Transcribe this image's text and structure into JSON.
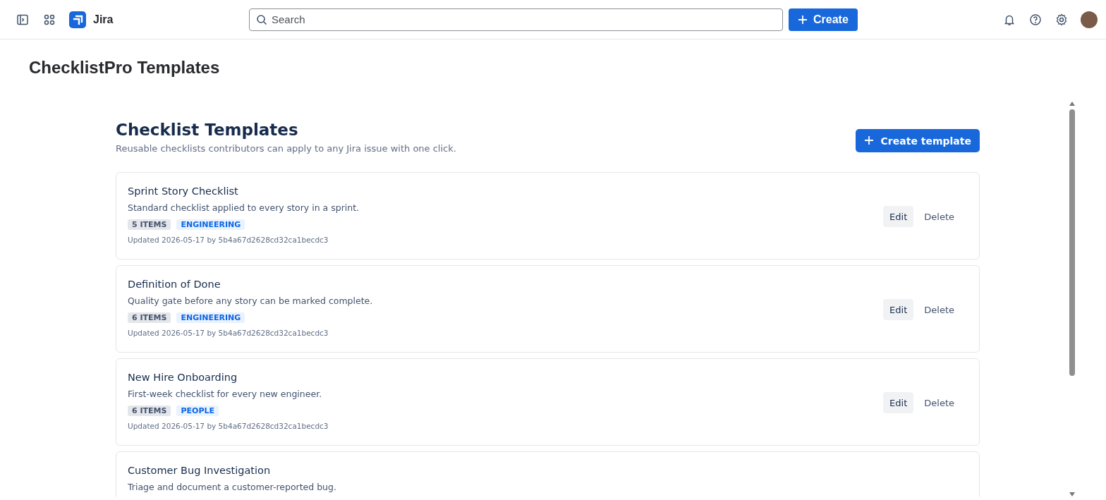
{
  "top_bar": {
    "product": "Jira",
    "search": {
      "placeholder": "Search"
    },
    "create_button": "Create"
  },
  "page_title": "ChecklistPro Templates",
  "section": {
    "title": "Checklist Templates",
    "subtitle": "Reusable checklists contributors can apply to any Jira issue with one click.",
    "create_button": "Create template"
  },
  "templates": [
    {
      "name": "Sprint Story Checklist",
      "description": "Standard checklist applied to every story in a sprint.",
      "count": "5 ITEMS",
      "category": "ENGINEERING",
      "updated": "Updated 2026-05-17 by 5b4a67d2628cd32ca1becdc3",
      "actions": [
        "Edit",
        "Delete"
      ]
    },
    {
      "name": "Definition of Done",
      "description": "Quality gate before any story can be marked complete.",
      "count": "6 ITEMS",
      "category": "ENGINEERING",
      "updated": "Updated 2026-05-17 by 5b4a67d2628cd32ca1becdc3",
      "actions": [
        "Edit",
        "Delete"
      ]
    },
    {
      "name": "New Hire Onboarding",
      "description": "First-week checklist for every new engineer.",
      "count": "6 ITEMS",
      "category": "PEOPLE",
      "updated": "Updated 2026-05-17 by 5b4a67d2628cd32ca1becdc3",
      "actions": [
        "Edit",
        "Delete"
      ]
    },
    {
      "name": "Customer Bug Investigation",
      "description": "Triage and document a customer-reported bug."
    }
  ]
}
